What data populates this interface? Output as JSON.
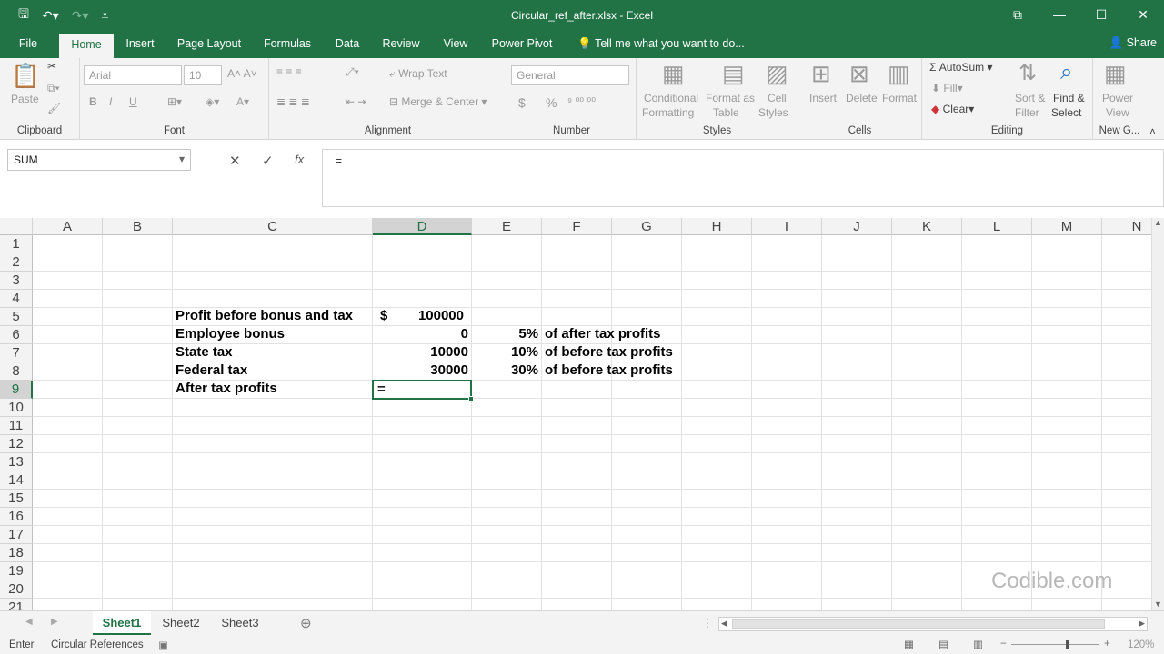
{
  "window": {
    "title": "Circular_ref_after.xlsx - Excel",
    "controls": [
      "⧉",
      "—",
      "☐",
      "✕"
    ]
  },
  "ribbon_tabs": [
    "File",
    "Home",
    "Insert",
    "Page Layout",
    "Formulas",
    "Data",
    "Review",
    "View",
    "Power Pivot",
    "Tell me what you want to do..."
  ],
  "share_label": "Share",
  "ribbon": {
    "clipboard": {
      "label": "Clipboard",
      "paste": "Paste"
    },
    "font": {
      "label": "Font",
      "family": "Arial",
      "size": "10",
      "bold": "B",
      "italic": "I",
      "underline": "U"
    },
    "alignment": {
      "label": "Alignment",
      "wrap": "Wrap Text",
      "merge": "Merge & Center"
    },
    "number": {
      "label": "Number",
      "format": "General",
      "currency": "$",
      "percent": "%"
    },
    "styles": {
      "label": "Styles",
      "conditional": "Conditional",
      "conditional2": "Formatting",
      "format_as": "Format as",
      "table": "Table",
      "cell": "Cell",
      "cell_styles": "Styles"
    },
    "cells": {
      "label": "Cells",
      "insert": "Insert",
      "delete": "Delete",
      "format": "Format"
    },
    "editing": {
      "label": "Editing",
      "autosum": "AutoSum",
      "fill": "Fill",
      "clear": "Clear",
      "sort": "Sort &",
      "filter": "Filter",
      "find": "Find &",
      "select": "Select"
    },
    "newgroup": {
      "label": "New G...",
      "power": "Power",
      "view": "View"
    }
  },
  "formula_bar": {
    "name_box": "SUM",
    "cancel": "✕",
    "enter": "✓",
    "fx": "fx",
    "formula": "="
  },
  "columns": [
    "A",
    "B",
    "C",
    "D",
    "E",
    "F",
    "G",
    "H",
    "I",
    "J",
    "K",
    "L",
    "M",
    "N"
  ],
  "rows": [
    "1",
    "2",
    "3",
    "4",
    "5",
    "6",
    "7",
    "8",
    "9",
    "10",
    "11",
    "12",
    "13",
    "14",
    "15",
    "16",
    "17",
    "18",
    "19",
    "20",
    "21"
  ],
  "cells": {
    "C5": "Profit before bonus and tax",
    "D5_sym": "$",
    "D5": "100000",
    "C6": "Employee bonus",
    "D6": "0",
    "E6": "5%",
    "F6": "of after tax profits",
    "C7": "State tax",
    "D7": "10000",
    "E7": "10%",
    "F7": "of before tax profits",
    "C8": "Federal tax",
    "D8": "30000",
    "E8": "30%",
    "F8": "of before tax profits",
    "C9": "After tax profits",
    "D9": "="
  },
  "watermark": "Codible.com",
  "sheets": [
    "Sheet1",
    "Sheet2",
    "Sheet3"
  ],
  "status": {
    "mode": "Enter",
    "circular": "Circular References",
    "zoom": "120%"
  },
  "colors": {
    "accent": "#217346",
    "ribbon": "#f3f3f3"
  }
}
